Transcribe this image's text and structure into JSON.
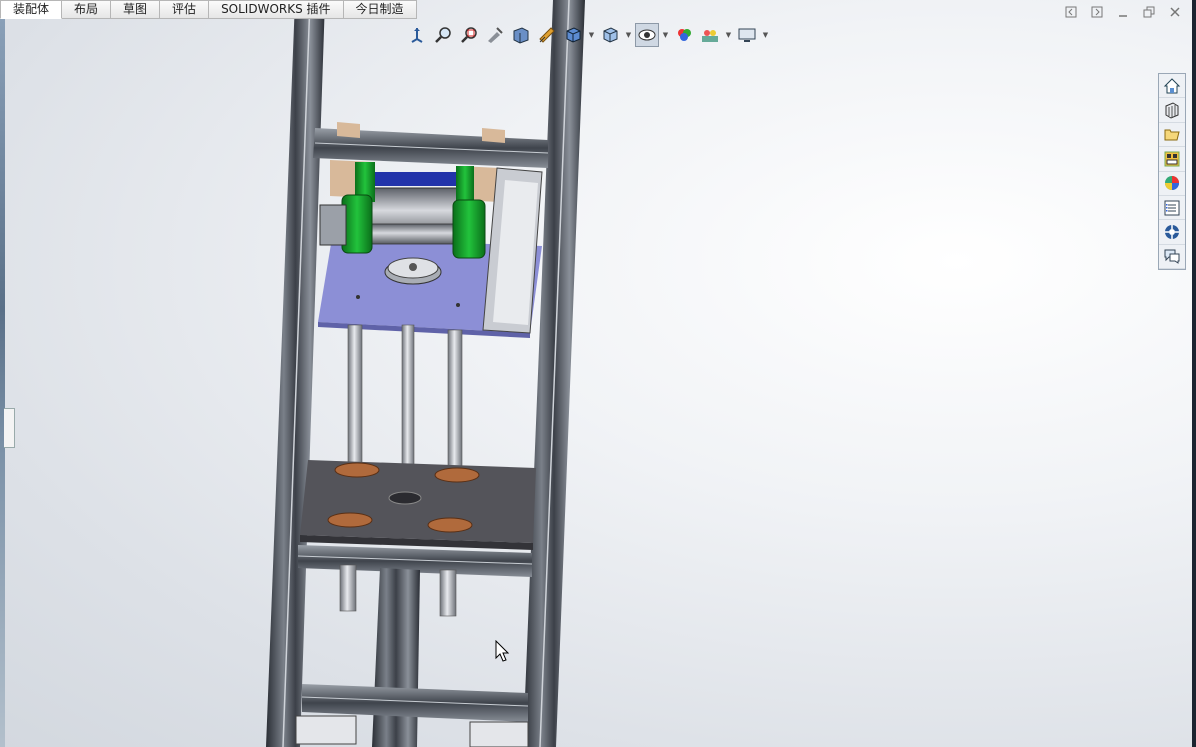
{
  "tabs": [
    {
      "label": "装配体",
      "active": true
    },
    {
      "label": "布局",
      "active": false
    },
    {
      "label": "草图",
      "active": false
    },
    {
      "label": "评估",
      "active": false
    },
    {
      "label": "SOLIDWORKS 插件",
      "active": false
    },
    {
      "label": "今日制造",
      "active": false
    }
  ],
  "hud_tools": [
    {
      "icon": "view-orientation-icon",
      "dropdown": false
    },
    {
      "icon": "zoom-to-fit-icon",
      "dropdown": false
    },
    {
      "icon": "zoom-to-area-icon",
      "dropdown": false
    },
    {
      "icon": "previous-view-icon",
      "dropdown": false
    },
    {
      "icon": "section-view-icon",
      "dropdown": false
    },
    {
      "icon": "dynamic-annotation-views-icon",
      "dropdown": false
    },
    {
      "icon": "view-orientation-cube-icon",
      "dropdown": true
    },
    {
      "icon": "display-style-icon",
      "dropdown": true
    },
    {
      "icon": "hide-show-items-icon",
      "dropdown": true,
      "pressed": true
    },
    {
      "icon": "edit-appearance-icon",
      "dropdown": false
    },
    {
      "icon": "apply-scene-icon",
      "dropdown": true
    },
    {
      "icon": "view-settings-icon",
      "dropdown": true
    }
  ],
  "window_controls": [
    "tile-left-icon",
    "tile-right-icon",
    "minimize-icon",
    "restore-icon",
    "close-icon"
  ],
  "task_pane": [
    "solidworks-resources-icon",
    "design-library-icon",
    "file-explorer-icon",
    "view-palette-icon",
    "appearances-scenes-icon",
    "custom-properties-icon",
    "solidworks-forum-icon",
    "discussion-icon"
  ],
  "colors": {
    "frame": "#4a4f58",
    "frame_dark": "#2b2f36",
    "green_bracket": "#14a12a",
    "plate_purple": "#8c8fd6",
    "base_plate": "#54545a",
    "wood_block": "#d8b99a",
    "flange": "#b06a3c",
    "rod": "#c9ccd2"
  }
}
